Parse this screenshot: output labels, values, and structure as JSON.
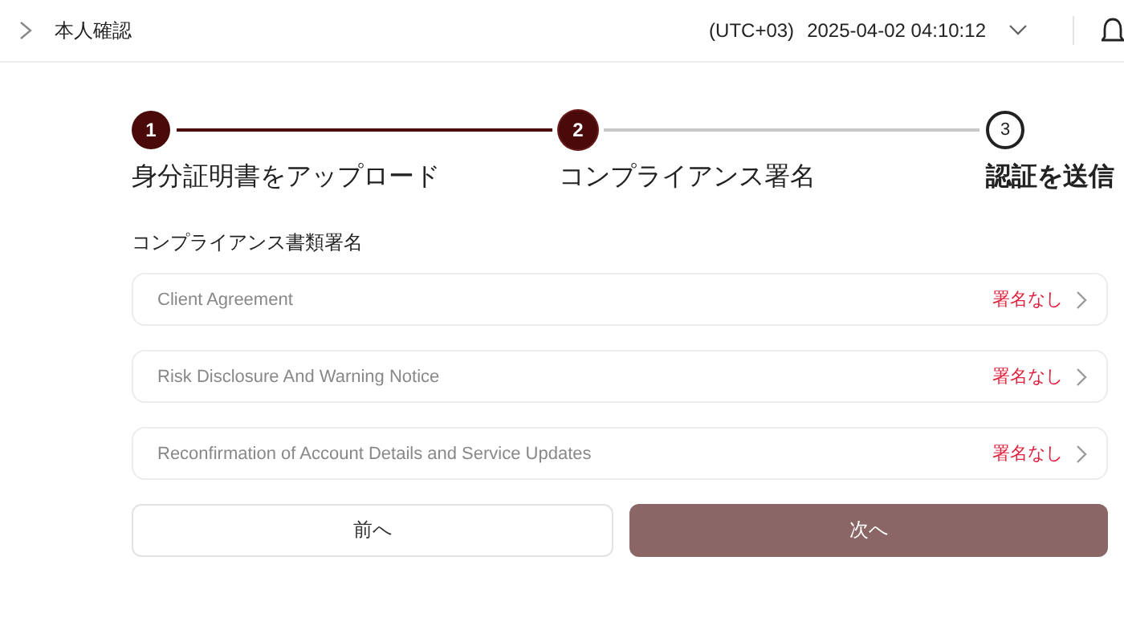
{
  "header": {
    "breadcrumb": "本人確認",
    "timezone": "(UTC+03)",
    "datetime": "2025-04-02 04:10:12"
  },
  "steps": [
    {
      "number": "1",
      "label": "身分証明書をアップロード",
      "done": true,
      "selected": false
    },
    {
      "number": "2",
      "label": "コンプライアンス署名",
      "done": false,
      "selected": true
    },
    {
      "number": "3",
      "label": "認証を送信",
      "done": false,
      "selected": false
    }
  ],
  "section_title": "コンプライアンス書類署名",
  "documents": [
    {
      "name": "Client Agreement",
      "status": "署名なし"
    },
    {
      "name": "Risk Disclosure And Warning Notice",
      "status": "署名なし"
    },
    {
      "name": "Reconfirmation of Account Details and Service Updates",
      "status": "署名なし"
    }
  ],
  "buttons": [
    {
      "label": "前へ",
      "kind": "secondary"
    },
    {
      "label": "次へ",
      "kind": "primary"
    }
  ]
}
